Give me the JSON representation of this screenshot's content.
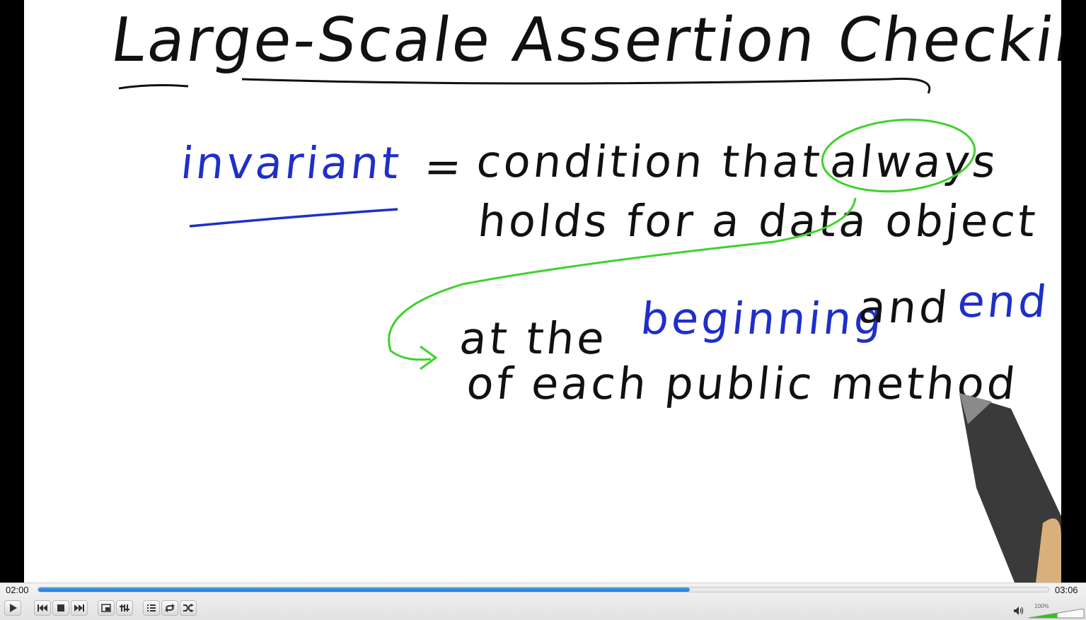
{
  "slide": {
    "title": "Large-Scale Assertion Checking",
    "term": "invariant",
    "equals": "=",
    "definition_line1_prefix": "condition that",
    "definition_emphasis": "always",
    "definition_line2": "holds for a data object",
    "detail_at_the": "at the",
    "detail_beginning": "beginning",
    "detail_and": "and",
    "detail_end": "end",
    "detail_line2": "of each public method"
  },
  "player": {
    "elapsed": "02:00",
    "duration": "03:06",
    "progress_percent": 64.5,
    "volume_label": "100%",
    "volume_percent": 100,
    "buttons": [
      "play-icon",
      "previous-icon",
      "stop-icon",
      "next-icon",
      "fullscreen-icon",
      "extended-settings-icon",
      "playlist-icon",
      "loop-icon",
      "shuffle-icon"
    ]
  },
  "colors": {
    "ink": "#111111",
    "blue_ink": "#1f2fc8",
    "green_ink": "#3fd12d",
    "progress": "#1f79d2",
    "volume": "#34c21e"
  }
}
